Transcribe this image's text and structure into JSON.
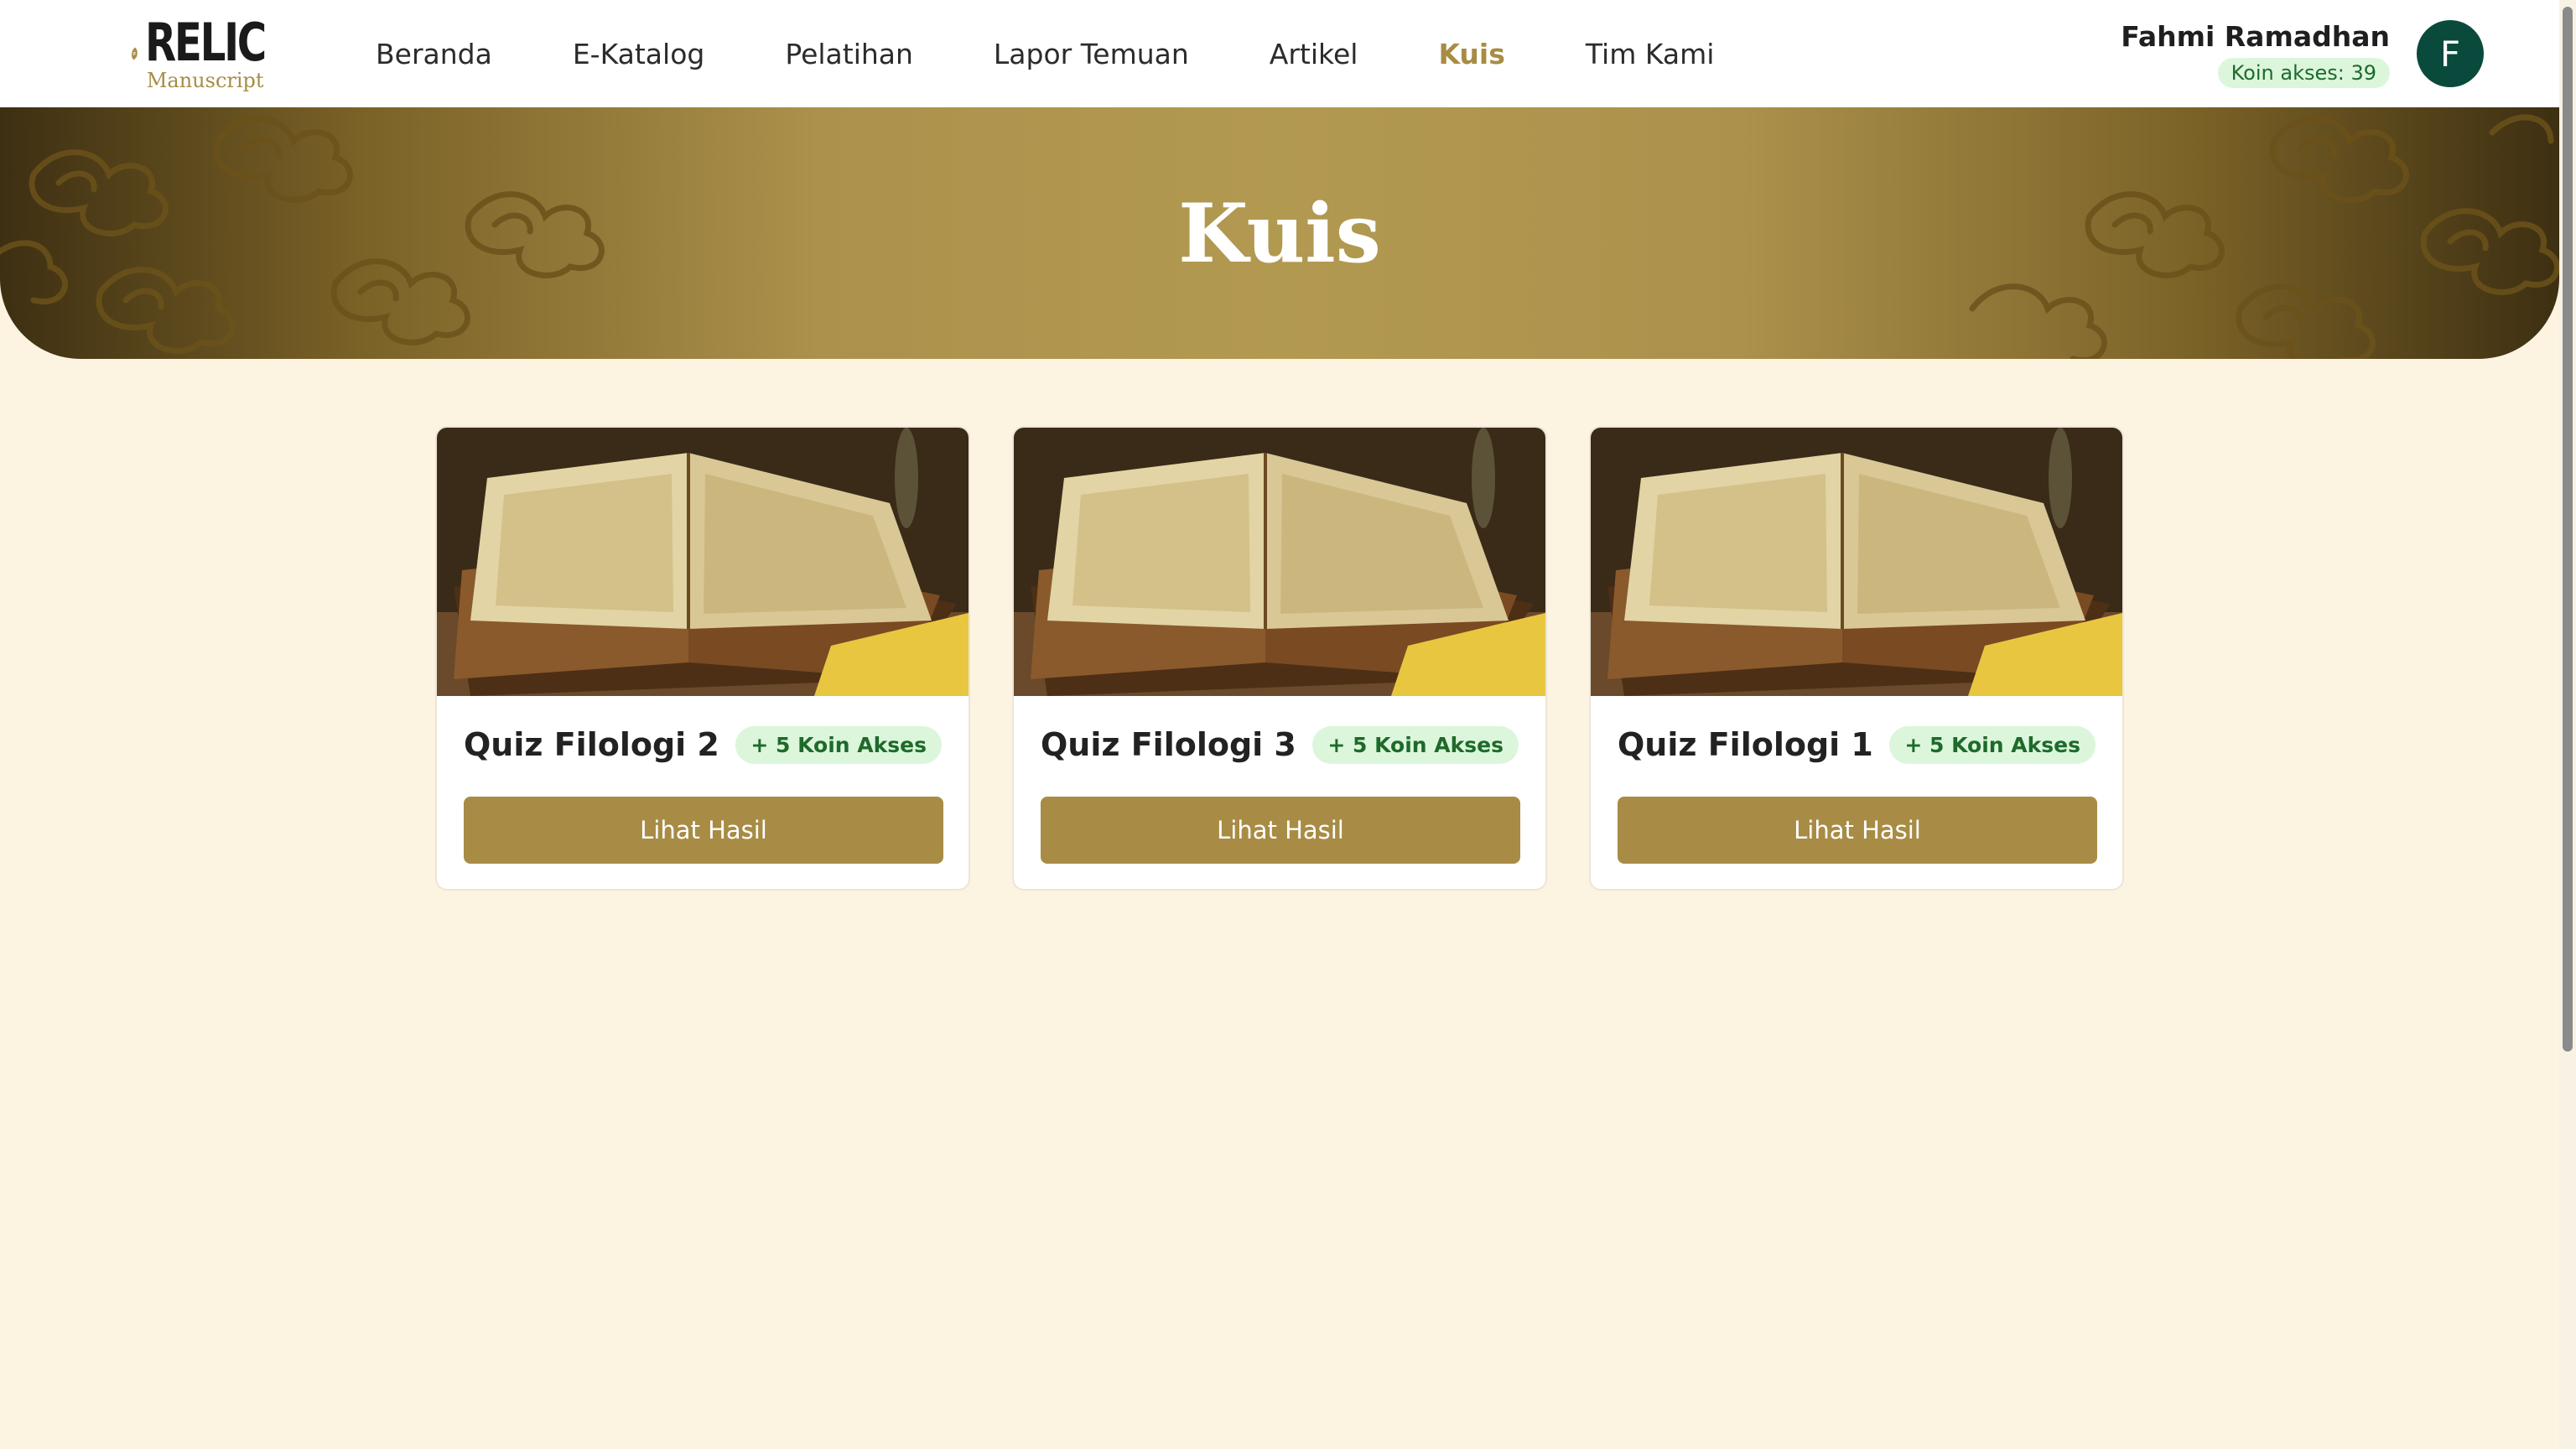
{
  "brand": {
    "name": "RELIC",
    "tagline": "Manuscript",
    "color": "#a88c45"
  },
  "nav": {
    "items": [
      {
        "label": "Beranda",
        "active": false
      },
      {
        "label": "E-Katalog",
        "active": false
      },
      {
        "label": "Pelatihan",
        "active": false
      },
      {
        "label": "Lapor Temuan",
        "active": false
      },
      {
        "label": "Artikel",
        "active": false
      },
      {
        "label": "Kuis",
        "active": true
      },
      {
        "label": "Tim Kami",
        "active": false
      }
    ]
  },
  "user": {
    "name": "Fahmi Ramadhan",
    "coins": "Koin akses: 39",
    "initial": "F",
    "avatar_color": "#0a4a3c"
  },
  "hero": {
    "title": "Kuis"
  },
  "quizzes": [
    {
      "title": "Quiz Filologi 2",
      "reward": "+ 5 Koin Akses",
      "button": "Lihat Hasil",
      "image": "open-book-painting"
    },
    {
      "title": "Quiz Filologi 3",
      "reward": "+ 5 Koin Akses",
      "button": "Lihat Hasil",
      "image": "open-book-painting"
    },
    {
      "title": "Quiz Filologi 1",
      "reward": "+ 5 Koin Akses",
      "button": "Lihat Hasil",
      "image": "open-book-painting"
    }
  ]
}
